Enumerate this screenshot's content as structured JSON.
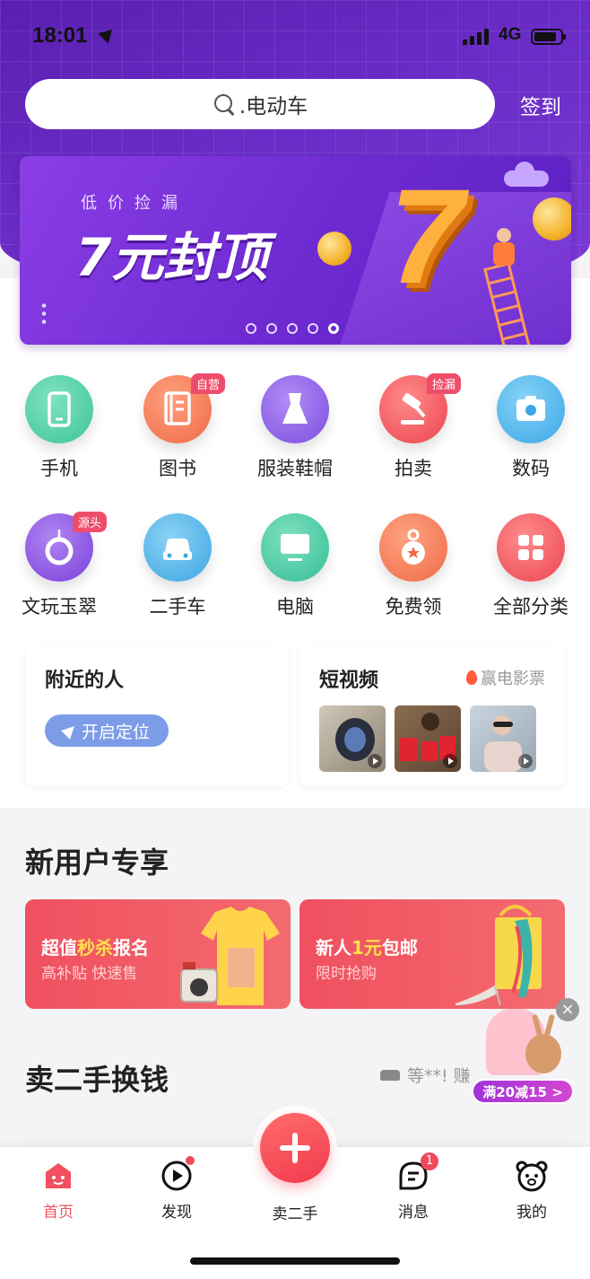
{
  "status_bar": {
    "time": "18:01",
    "network": "4G"
  },
  "search": {
    "placeholder": ".电动车"
  },
  "header": {
    "signin_label": "签到"
  },
  "banner": {
    "tagline": "低价捡漏",
    "headline": "7元封顶",
    "big_number": "7",
    "pages": 5,
    "active_page": 5
  },
  "categories": [
    {
      "label": "手机",
      "icon": "phone-icon",
      "color": "#4ecfa6"
    },
    {
      "label": "图书",
      "icon": "book-icon",
      "color": "#f57f5b",
      "badge": "自营"
    },
    {
      "label": "服装鞋帽",
      "icon": "dress-icon",
      "color": "#9063e8"
    },
    {
      "label": "拍卖",
      "icon": "gavel-icon",
      "color": "#f0585f",
      "badge": "捡漏"
    },
    {
      "label": "数码",
      "icon": "camera-icon",
      "color": "#4cb5ec"
    },
    {
      "label": "文玩玉翠",
      "icon": "jade-icon",
      "color": "#8a53df",
      "badge": "源头"
    },
    {
      "label": "二手车",
      "icon": "car-icon",
      "color": "#4fb3e8"
    },
    {
      "label": "电脑",
      "icon": "monitor-icon",
      "color": "#3fc9a2"
    },
    {
      "label": "免费领",
      "icon": "medal-icon",
      "color": "#f57f5b"
    },
    {
      "label": "全部分类",
      "icon": "grid-icon",
      "color": "#f0585f"
    }
  ],
  "nearby": {
    "title": "附近的人",
    "button": "开启定位"
  },
  "short_video": {
    "title": "短视频",
    "prize": "赢电影票"
  },
  "new_user": {
    "title": "新用户专享",
    "promos": [
      {
        "title_a": "超值",
        "title_b": "秒杀",
        "title_c": "报名",
        "subtitle": "高补贴 快速售"
      },
      {
        "title_a": "新人",
        "title_b": "1元",
        "title_c": "包邮",
        "subtitle": "限时抢购"
      }
    ]
  },
  "sell": {
    "title": "卖二手换钱",
    "hint": "等**! 赚"
  },
  "float_ad": {
    "tag": "满20减15 >",
    "close": "×"
  },
  "tabbar": {
    "home": "首页",
    "discover": "发现",
    "sell": "卖二手",
    "messages": "消息",
    "me": "我的",
    "messages_badge": "1",
    "active": "home",
    "active_color": "#f0505f"
  }
}
